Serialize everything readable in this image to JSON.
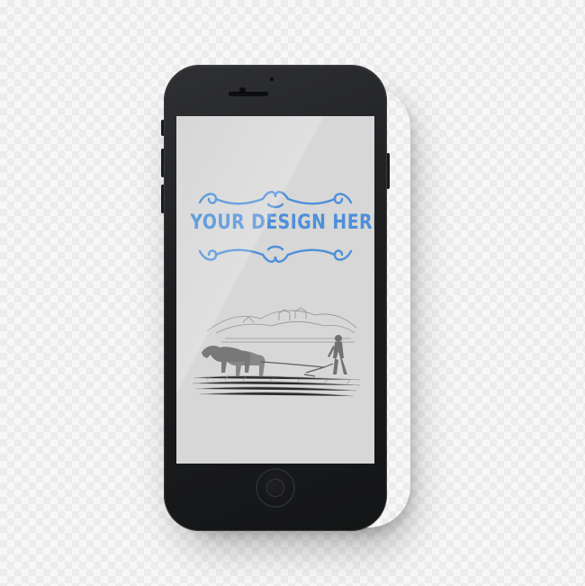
{
  "device": {
    "model": "smartphone-mockup",
    "body_color": "#1e1f21",
    "screen_color": "#d7d7d7"
  },
  "screen": {
    "headline": "YOUR DESIGN HERE!",
    "accent_color": "#4e8fd9",
    "ornament_top": "flourish-divider",
    "ornament_bottom": "flourish-divider",
    "illustration": "engraving-farmer-plowing-with-horses"
  }
}
